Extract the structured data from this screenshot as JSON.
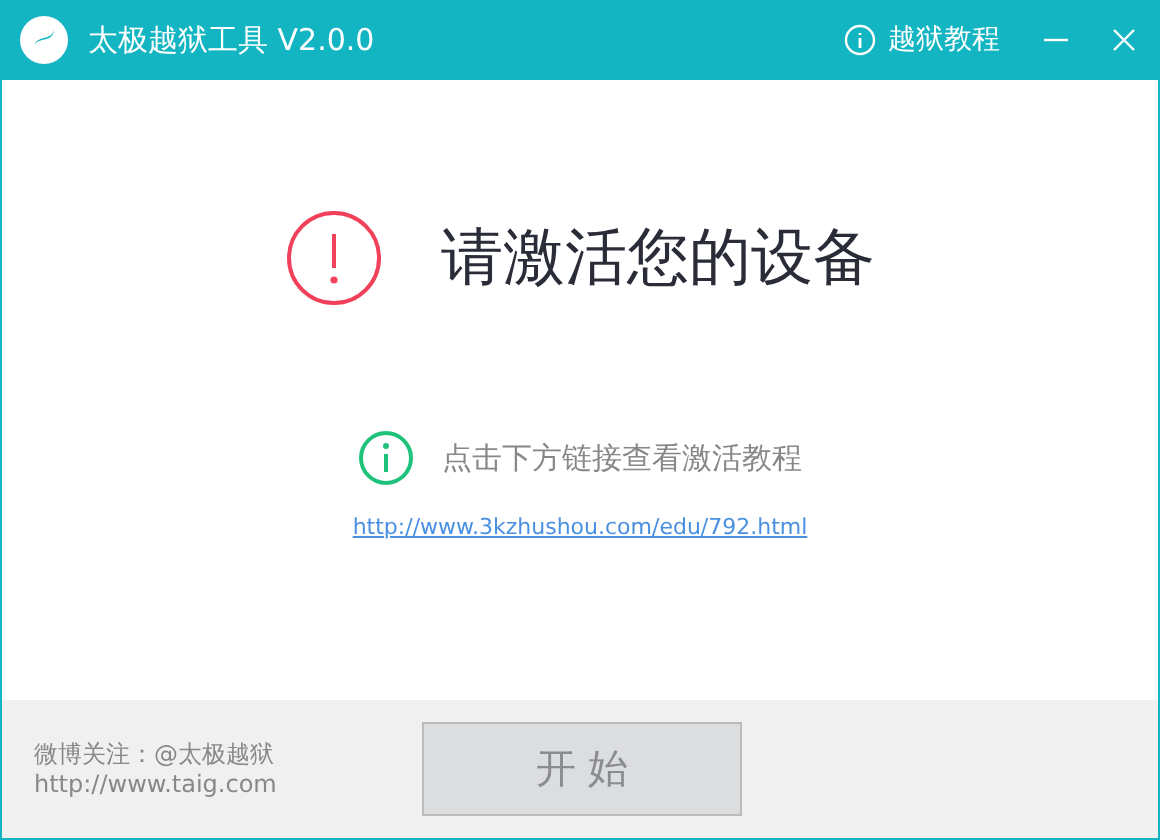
{
  "window": {
    "title": "太极越狱工具 V2.0.0",
    "help_link": "越狱教程"
  },
  "message": {
    "heading": "请激活您的设备",
    "hint": "点击下方链接查看激活教程",
    "link": "http://www.3kzhushou.com/edu/792.html"
  },
  "footer": {
    "weibo": "微博关注：@太极越狱",
    "site": "http://www.taig.com",
    "start_button": {
      "label": "开 始",
      "disabled": true
    }
  }
}
